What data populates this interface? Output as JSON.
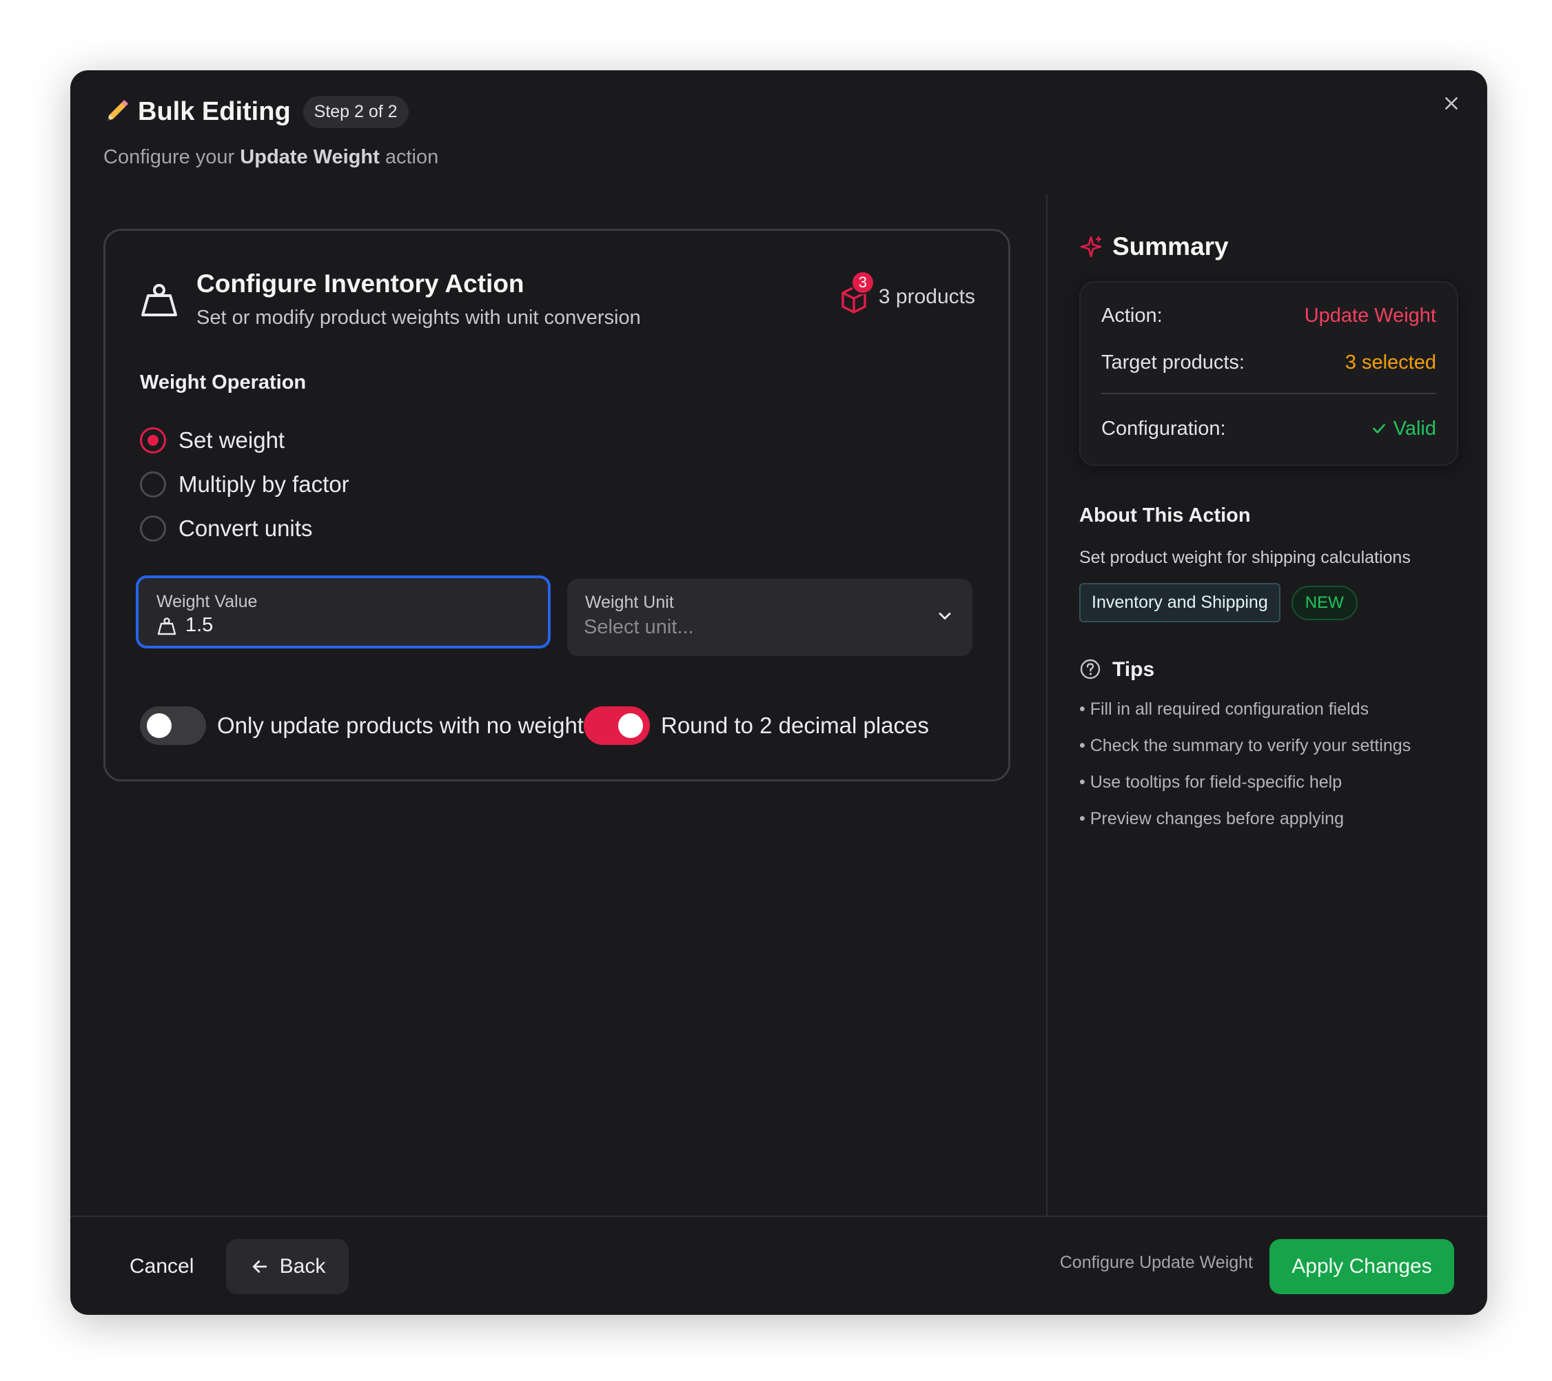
{
  "dialog": {
    "title": "Bulk Editing",
    "step": "Step 2 of 2",
    "subtitle_prefix": "Configure your",
    "subtitle_action": "Update Weight",
    "subtitle_suffix": "action"
  },
  "card": {
    "title": "Configure Inventory Action",
    "description": "Set or modify product weights with unit conversion",
    "product_count_badge": "3",
    "products_label": "3 products",
    "operation_label": "Weight Operation",
    "operations": [
      {
        "label": "Set weight",
        "selected": true
      },
      {
        "label": "Multiply by factor",
        "selected": false
      },
      {
        "label": "Convert units",
        "selected": false
      }
    ],
    "weight_value": {
      "label": "Weight Value",
      "value": "1.5"
    },
    "weight_unit": {
      "label": "Weight Unit",
      "placeholder": "Select unit..."
    },
    "toggles": [
      {
        "label": "Only update products with no weight",
        "on": false
      },
      {
        "label": "Round to 2 decimal places",
        "on": true
      }
    ]
  },
  "summary": {
    "title": "Summary",
    "rows": [
      {
        "key": "Action:",
        "value": "Update Weight"
      },
      {
        "key": "Target products:",
        "value": "3 selected"
      },
      {
        "key": "Configuration:",
        "value": "Valid"
      }
    ]
  },
  "about": {
    "title": "About This Action",
    "description": "Set product weight for shipping calculations",
    "category": "Inventory and Shipping",
    "badge": "NEW"
  },
  "tips": {
    "title": "Tips",
    "items": [
      "Fill in all required configuration fields",
      "Check the summary to verify your settings",
      "Use tooltips for field-specific help",
      "Preview changes before applying"
    ]
  },
  "footer": {
    "cancel_label": "Cancel",
    "back_label": "Back",
    "hint": "Configure Update Weight",
    "apply_label": "Apply Changes"
  },
  "colors": {
    "accent": "#e11d48",
    "primary_button": "#16a34a",
    "focus_ring": "#2563eb",
    "warning": "#f59e0b",
    "success": "#22c55e"
  },
  "icons": [
    "pencil-icon",
    "close-icon",
    "weight-icon",
    "cube-icon",
    "chevron-down-icon",
    "sparkle-icon",
    "check-icon",
    "help-circle-icon",
    "arrow-left-icon"
  ]
}
